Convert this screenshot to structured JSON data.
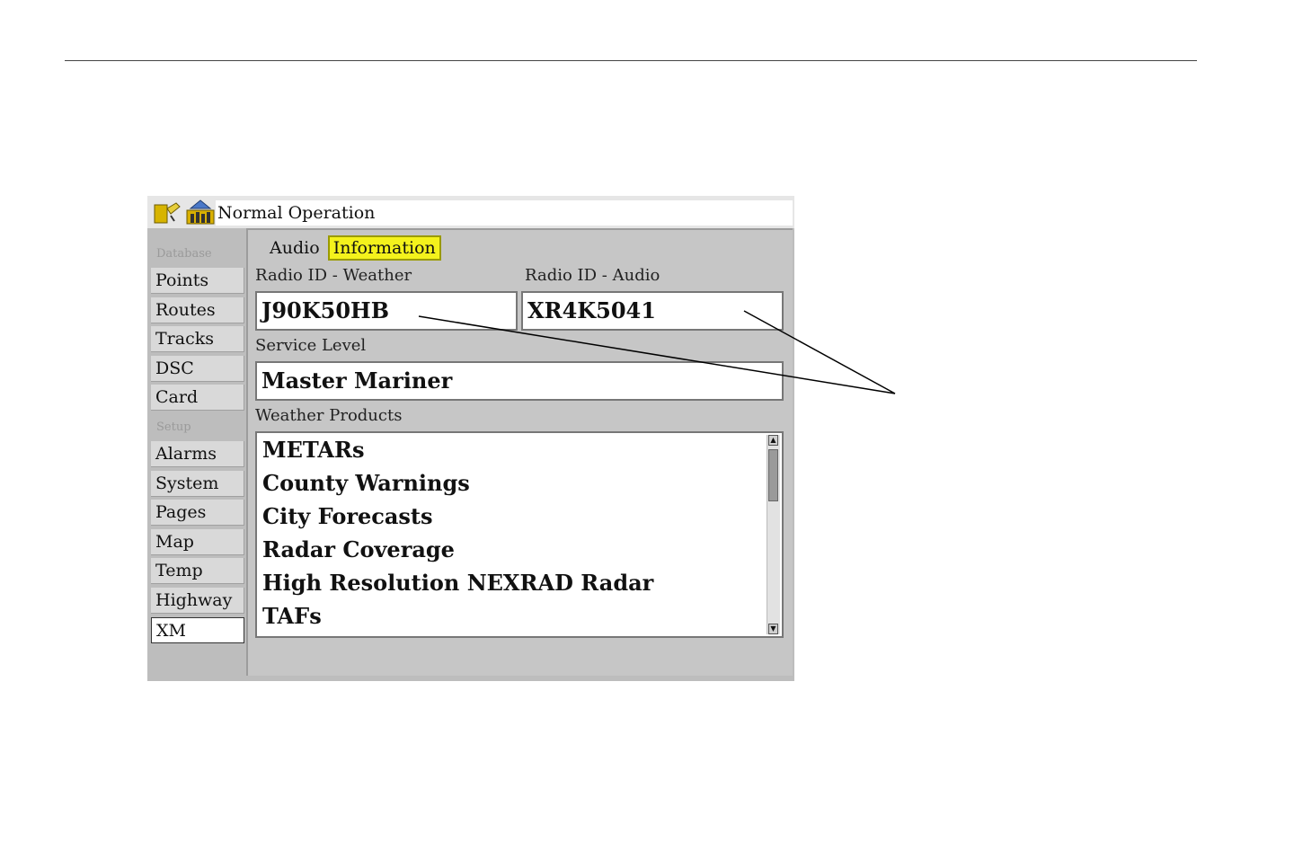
{
  "title_bar": {
    "status_text": "Normal Operation",
    "icons": [
      "gps-satellite-icon",
      "signal-bars-icon"
    ]
  },
  "sidebar": {
    "sections": [
      {
        "heading": "Database",
        "items": [
          "Points",
          "Routes",
          "Tracks",
          "DSC",
          "Card"
        ]
      },
      {
        "heading": "Setup",
        "items": [
          "Alarms",
          "System",
          "Pages",
          "Map",
          "Temp",
          "Highway",
          "XM"
        ]
      }
    ],
    "selected_item": "XM"
  },
  "tabs": [
    {
      "label": "Audio",
      "active": false
    },
    {
      "label": "Information",
      "active": true
    }
  ],
  "info": {
    "radio_id_weather_label": "Radio ID - Weather",
    "radio_id_weather_value": "J90K50HB",
    "radio_id_audio_label": "Radio ID - Audio",
    "radio_id_audio_value": "XR4K5041",
    "service_level_label": "Service Level",
    "service_level_value": "Master Mariner",
    "weather_products_label": "Weather Products",
    "weather_products": [
      "METARs",
      "County Warnings",
      "City Forecasts",
      "Radar Coverage",
      "High Resolution NEXRAD Radar",
      "TAFs"
    ]
  },
  "colors": {
    "active_tab": "#f4f21c",
    "device_bg": "#bdbdbd",
    "panel_bg": "#c6c6c6"
  }
}
